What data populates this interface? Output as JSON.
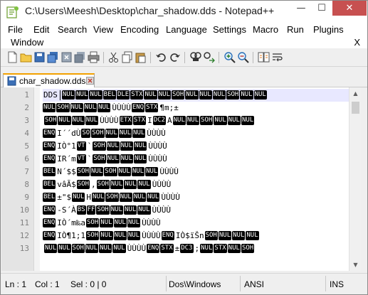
{
  "window": {
    "title": "C:\\Users\\Meesh\\Desktop\\char_shadow.dds - Notepad++",
    "minimize": "—",
    "maximize": "☐",
    "close": "✕"
  },
  "menu": {
    "items": [
      "File",
      "Edit",
      "Search",
      "View",
      "Encoding",
      "Language",
      "Settings",
      "Macro",
      "Run",
      "Plugins",
      "Window"
    ],
    "close_doc": "X"
  },
  "toolbar": {
    "icons": [
      "new-file-icon",
      "open-file-icon",
      "save-icon",
      "save-all-icon",
      "close-icon",
      "close-all-icon",
      "print-icon",
      "cut-icon",
      "copy-icon",
      "paste-icon",
      "undo-icon",
      "redo-icon",
      "find-icon",
      "replace-icon",
      "zoom-in-icon",
      "zoom-out-icon",
      "sync-scroll-icon",
      "word-wrap-icon"
    ]
  },
  "tab": {
    "label": "char_shadow.dds",
    "accent": "#f2a100"
  },
  "editor": {
    "line_numbers": [
      "1",
      "2",
      "3",
      "4",
      "5",
      "6",
      "7",
      "8",
      "9",
      "10",
      "11",
      "12",
      "13"
    ],
    "lines": [
      [
        [
          "t",
          "DDS "
        ],
        [
          "caret",
          ""
        ],
        [
          "c",
          "NUL"
        ],
        [
          "c",
          "NUL"
        ],
        [
          "c",
          "NUL"
        ],
        [
          "c",
          "BEL"
        ],
        [
          "c",
          "DLE"
        ],
        [
          "c",
          "STX"
        ],
        [
          "c",
          "NUL"
        ],
        [
          "c",
          "NUL"
        ],
        [
          "c",
          "SOH"
        ],
        [
          "c",
          "NUL"
        ],
        [
          "c",
          "NUL"
        ],
        [
          "c",
          "NUL"
        ],
        [
          "c",
          "SOH"
        ],
        [
          "c",
          "NUL"
        ],
        [
          "c",
          "NUL"
        ]
      ],
      [
        [
          "c",
          "NUL"
        ],
        [
          "c",
          "SOH"
        ],
        [
          "c",
          "NUL"
        ],
        [
          "c",
          "NUL"
        ],
        [
          "c",
          "NUL"
        ],
        [
          "t",
          "ÙÙÙÙ"
        ],
        [
          "c",
          "ENQ"
        ],
        [
          "c",
          "STX"
        ],
        [
          "t",
          "¶m;±"
        ]
      ],
      [
        [
          "t",
          " "
        ],
        [
          "c",
          "SOH"
        ],
        [
          "c",
          "NUL"
        ],
        [
          "c",
          "NUL"
        ],
        [
          "c",
          "NUL"
        ],
        [
          "t",
          "ÙÙÙÙ"
        ],
        [
          "c",
          "ETX"
        ],
        [
          "c",
          "STX"
        ],
        [
          "t",
          "I"
        ],
        [
          "c",
          "DC2"
        ],
        [
          "t",
          " A"
        ],
        [
          "c",
          "NUL"
        ],
        [
          "c",
          "NUL"
        ],
        [
          "c",
          "SOH"
        ],
        [
          "c",
          "NUL"
        ],
        [
          "c",
          "NUL"
        ],
        [
          "c",
          "NUL"
        ]
      ],
      [
        [
          "c",
          "ENQ"
        ],
        [
          "t",
          "I´´dÙ"
        ],
        [
          "c",
          "SO"
        ],
        [
          "c",
          "SOH"
        ],
        [
          "c",
          "NUL"
        ],
        [
          "c",
          "NUL"
        ],
        [
          "c",
          "NUL"
        ],
        [
          "t",
          "ÙÙÙÙ"
        ]
      ],
      [
        [
          "c",
          "ENQ"
        ],
        [
          "t",
          "IÒ°1"
        ],
        [
          "c",
          "VT"
        ],
        [
          "t",
          "`"
        ],
        [
          "c",
          "SOH"
        ],
        [
          "c",
          "NUL"
        ],
        [
          "c",
          "NUL"
        ],
        [
          "c",
          "NUL"
        ],
        [
          "t",
          "ÙÙÙÙ"
        ]
      ],
      [
        [
          "c",
          "ENQ"
        ],
        [
          "t",
          "IR´m"
        ],
        [
          "c",
          "VT"
        ],
        [
          "t",
          "`"
        ],
        [
          "c",
          "SOH"
        ],
        [
          "c",
          "NUL"
        ],
        [
          "c",
          "NUL"
        ],
        [
          "c",
          "NUL"
        ],
        [
          "t",
          "ÙÙÙÙ"
        ]
      ],
      [
        [
          "c",
          "BEL"
        ],
        [
          "t",
          "N´$$"
        ],
        [
          "c",
          "SOH"
        ],
        [
          "c",
          "NUL"
        ],
        [
          "c",
          "SOH"
        ],
        [
          "c",
          "NUL"
        ],
        [
          "c",
          "NUL"
        ],
        [
          "c",
          "NUL"
        ],
        [
          "t",
          "ÙÙÙÙ"
        ]
      ],
      [
        [
          "c",
          "BEL"
        ],
        [
          "t",
          "vâÃ$"
        ],
        [
          "c",
          "SOH"
        ],
        [
          "t",
          ","
        ],
        [
          "c",
          "SOH"
        ],
        [
          "c",
          "NUL"
        ],
        [
          "c",
          "NUL"
        ],
        [
          "c",
          "NUL"
        ],
        [
          "t",
          "ÙÙÙÙ"
        ]
      ],
      [
        [
          "c",
          "BEL"
        ],
        [
          "t",
          "±\"$"
        ],
        [
          "c",
          "NUL"
        ],
        [
          "t",
          "H"
        ],
        [
          "c",
          "NUL"
        ],
        [
          "c",
          "SOH"
        ],
        [
          "c",
          "NUL"
        ],
        [
          "c",
          "NUL"
        ],
        [
          "c",
          "NUL"
        ],
        [
          "t",
          "ÙÙÙÙ"
        ]
      ],
      [
        [
          "c",
          "ENQ"
        ],
        [
          "t",
          "-S´À"
        ],
        [
          "c",
          "BS"
        ],
        [
          "c",
          "FF"
        ],
        [
          "c",
          "SOH"
        ],
        [
          "c",
          "NUL"
        ],
        [
          "c",
          "NUL"
        ],
        [
          "c",
          "NUL"
        ],
        [
          "t",
          "ÙÙÙÙ"
        ]
      ],
      [
        [
          "c",
          "ENQ"
        ],
        [
          "t",
          "IÒ´m‰a"
        ],
        [
          "c",
          "SOH"
        ],
        [
          "c",
          "NUL"
        ],
        [
          "c",
          "NUL"
        ],
        [
          "c",
          "NUL"
        ],
        [
          "t",
          "ÙÙÙÙ"
        ]
      ],
      [
        [
          "c",
          "ENQ"
        ],
        [
          "t",
          "IÒ¶1;1"
        ],
        [
          "c",
          "SOH"
        ],
        [
          "c",
          "NUL"
        ],
        [
          "c",
          "NUL"
        ],
        [
          "c",
          "NUL"
        ],
        [
          "t",
          "ÙÙÙÙ  "
        ],
        [
          "c",
          "ENQ"
        ],
        [
          "t",
          "IÒ$ïŠn"
        ],
        [
          "c",
          "SOH"
        ],
        [
          "c",
          "NUL"
        ],
        [
          "c",
          "NUL"
        ],
        [
          "c",
          "NUL"
        ]
      ],
      [
        [
          "t",
          " "
        ],
        [
          "c",
          "NUL"
        ],
        [
          "c",
          "NUL"
        ],
        [
          "c",
          "SOH"
        ],
        [
          "c",
          "NUL"
        ],
        [
          "c",
          "NUL"
        ],
        [
          "c",
          "NUL"
        ],
        [
          "t",
          "ÙÙÙÙ"
        ],
        [
          "c",
          "ENQ"
        ],
        [
          "c",
          "STX"
        ],
        [
          "t",
          "±"
        ],
        [
          "c",
          "DC3"
        ],
        [
          "t",
          ";"
        ],
        [
          "c",
          "NUL"
        ],
        [
          "c",
          "STX"
        ],
        [
          "c",
          "NUL"
        ],
        [
          "c",
          "SOH"
        ]
      ]
    ]
  },
  "scrollbar": {
    "up_arrow": "▲",
    "down_arrow": "▼"
  },
  "status": {
    "ln": "Ln : 1",
    "col": "Col : 1",
    "sel": "Sel : 0 | 0",
    "eol": "Dos\\Windows",
    "encoding": "ANSI",
    "mode": "INS"
  }
}
